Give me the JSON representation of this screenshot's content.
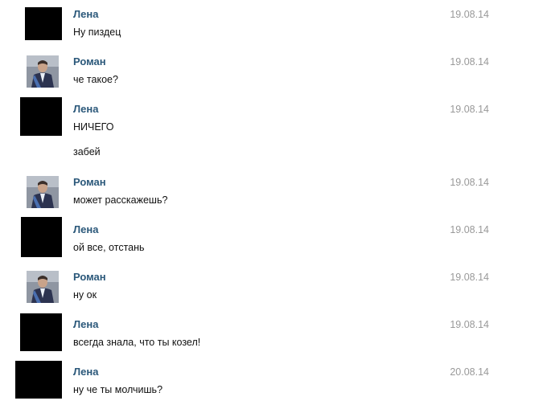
{
  "messages": [
    {
      "author": "Лена",
      "date": "19.08.14",
      "avatar": "black-square",
      "lines": [
        "Ну пиздец"
      ]
    },
    {
      "author": "Роман",
      "date": "19.08.14",
      "avatar": "user-photo",
      "lines": [
        "че такое?"
      ]
    },
    {
      "author": "Лена",
      "date": "19.08.14",
      "avatar": "black-square",
      "lines": [
        "НИЧЕГО",
        "забей"
      ]
    },
    {
      "author": "Роман",
      "date": "19.08.14",
      "avatar": "user-photo",
      "lines": [
        "может расскажешь?"
      ]
    },
    {
      "author": "Лена",
      "date": "19.08.14",
      "avatar": "black-square",
      "lines": [
        "ой все, отстань"
      ]
    },
    {
      "author": "Роман",
      "date": "19.08.14",
      "avatar": "user-photo",
      "lines": [
        "ну ок"
      ]
    },
    {
      "author": "Лена",
      "date": "19.08.14",
      "avatar": "black-square",
      "lines": [
        "всегда знала, что ты козел!"
      ]
    },
    {
      "author": "Лена",
      "date": "20.08.14",
      "avatar": "black-square",
      "lines": [
        "ну че ты молчишь?"
      ]
    }
  ],
  "colors": {
    "author": "#2b587a",
    "date": "#999999",
    "text": "#111111",
    "background": "#ffffff"
  }
}
